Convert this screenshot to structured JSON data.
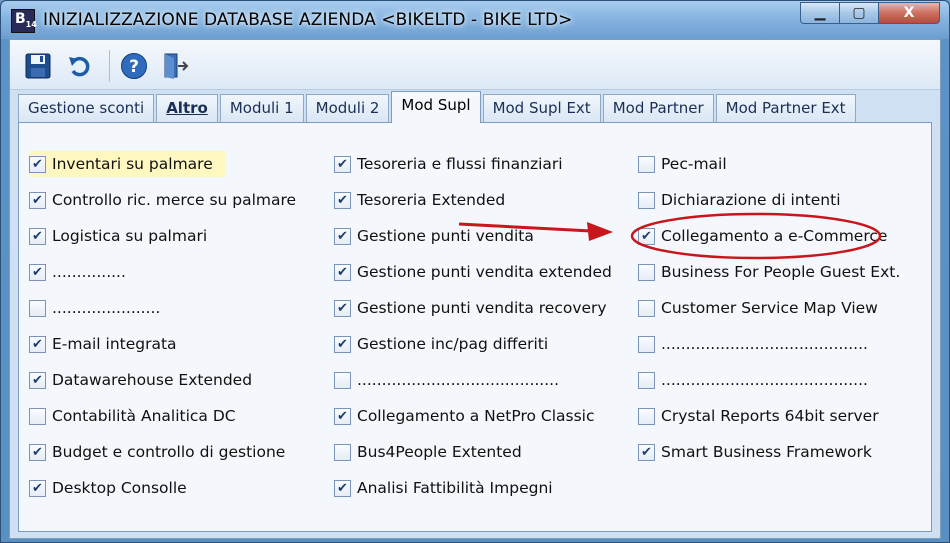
{
  "window": {
    "icon_label": "B",
    "icon_sub": "14",
    "title": "INIZIALIZZAZIONE DATABASE AZIENDA <BIKELTD - BIKE LTD>",
    "controls": {
      "minimize": "▁",
      "maximize": "▢",
      "close": "X"
    }
  },
  "toolbar": {
    "buttons": [
      "save-icon",
      "undo-icon",
      "help-icon",
      "exit-icon"
    ]
  },
  "tabs": [
    {
      "label": "Gestione sconti",
      "active": false
    },
    {
      "label": "Altro",
      "active": false,
      "bold": true
    },
    {
      "label": "Moduli 1",
      "active": false
    },
    {
      "label": "Moduli 2",
      "active": false
    },
    {
      "label": "Mod Supl",
      "active": true
    },
    {
      "label": "Mod Supl Ext",
      "active": false
    },
    {
      "label": "Mod Partner",
      "active": false
    },
    {
      "label": "Mod Partner Ext",
      "active": false
    }
  ],
  "columns": [
    [
      {
        "label": "Inventari su palmare",
        "checked": true
      },
      {
        "label": "Controllo ric. merce su palmare",
        "checked": true
      },
      {
        "label": "Logistica su palmari",
        "checked": true
      },
      {
        "label": "...............",
        "checked": true
      },
      {
        "label": "......................",
        "checked": false
      },
      {
        "label": "E-mail integrata",
        "checked": true
      },
      {
        "label": "Datawarehouse Extended",
        "checked": true
      },
      {
        "label": "Contabilità Analitica DC",
        "checked": false
      },
      {
        "label": "Budget e controllo di gestione",
        "checked": true
      },
      {
        "label": "Desktop Consolle",
        "checked": true
      }
    ],
    [
      {
        "label": "Tesoreria e flussi finanziari",
        "checked": true
      },
      {
        "label": "Tesoreria Extended",
        "checked": true
      },
      {
        "label": "Gestione punti vendita",
        "checked": true
      },
      {
        "label": "Gestione punti vendita extended",
        "checked": true
      },
      {
        "label": "Gestione punti vendita recovery",
        "checked": true
      },
      {
        "label": "Gestione inc/pag differiti",
        "checked": true
      },
      {
        "label": ".........................................",
        "checked": false
      },
      {
        "label": "Collegamento a NetPro Classic",
        "checked": true
      },
      {
        "label": "Bus4People Extented",
        "checked": false
      },
      {
        "label": "Analisi Fattibilità Impegni",
        "checked": true
      }
    ],
    [
      {
        "label": "Pec-mail",
        "checked": false
      },
      {
        "label": "Dichiarazione di intenti",
        "checked": false
      },
      {
        "label": "Collegamento a e-Commerce",
        "checked": true
      },
      {
        "label": "Business For People Guest Ext.",
        "checked": false
      },
      {
        "label": "Customer Service Map View",
        "checked": false
      },
      {
        "label": "..........................................",
        "checked": false
      },
      {
        "label": "..........................................",
        "checked": false
      },
      {
        "label": "Crystal Reports 64bit server",
        "checked": false
      },
      {
        "label": "Smart Business Framework",
        "checked": true
      }
    ]
  ],
  "colors": {
    "annotation": "#c8161d",
    "accent": "#1a2f55"
  }
}
